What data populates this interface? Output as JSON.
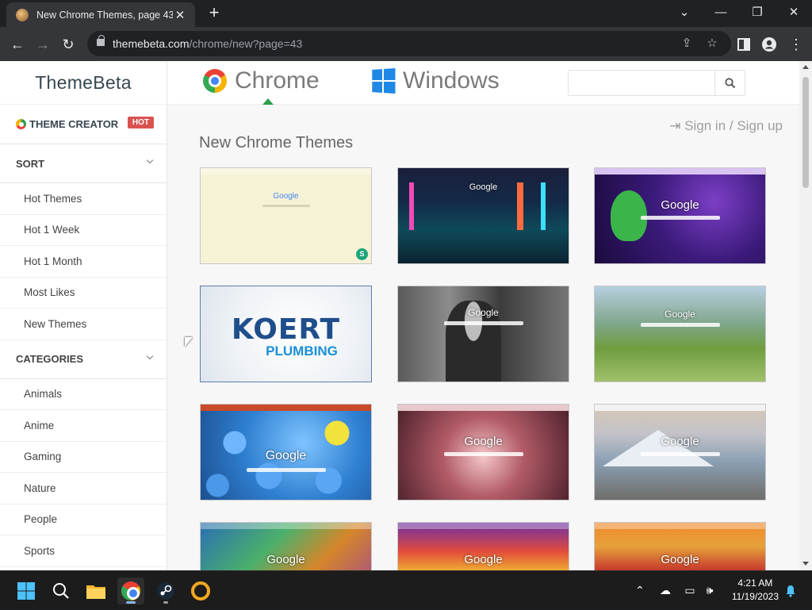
{
  "browser": {
    "tab_title": "New Chrome Themes, page 43 -",
    "url_host": "themebeta.com",
    "url_path": "/chrome/new?page=43"
  },
  "sidebar": {
    "logo": "ThemeBeta",
    "creator_label": "THEME CREATOR",
    "creator_badge": "HOT",
    "sort_heading": "SORT",
    "sort_items": [
      {
        "label": "Hot Themes"
      },
      {
        "label": "Hot 1 Week"
      },
      {
        "label": "Hot 1 Month"
      },
      {
        "label": "Most Likes"
      },
      {
        "label": "New Themes"
      }
    ],
    "categories_heading": "CATEGORIES",
    "category_items": [
      {
        "label": "Animals"
      },
      {
        "label": "Anime"
      },
      {
        "label": "Gaming"
      },
      {
        "label": "Nature"
      },
      {
        "label": "People"
      },
      {
        "label": "Sports"
      }
    ]
  },
  "topnav": {
    "chrome_label": "Chrome",
    "windows_label": "Windows",
    "search_placeholder": ""
  },
  "main": {
    "signin": "Sign in / Sign up",
    "heading": "New Chrome Themes",
    "thumbnails": [
      {
        "name": "pastel-cream-theme",
        "google": "Google",
        "badge": "S"
      },
      {
        "name": "neon-city-street-theme",
        "google": "Google"
      },
      {
        "name": "green-frog-space-theme",
        "google": "Google"
      },
      {
        "name": "koert-plumbing-theme",
        "brand": "KOERT",
        "sub": "PLUMBING"
      },
      {
        "name": "monochrome-singer-theme",
        "google": "Google"
      },
      {
        "name": "green-meadow-theme",
        "google": "Google"
      },
      {
        "name": "blue-smiley-balls-theme",
        "google": "Google"
      },
      {
        "name": "anime-girl-red-theme",
        "google": "Google"
      },
      {
        "name": "mount-fuji-girl-theme",
        "google": "Google"
      },
      {
        "name": "colorful-abstract-theme-1",
        "google": "Google"
      },
      {
        "name": "rainbow-abstract-theme-2",
        "google": "Google"
      },
      {
        "name": "rainbow-abstract-theme-3",
        "google": "Google"
      }
    ]
  },
  "taskbar": {
    "time": "4:21 AM",
    "date": "11/19/2023"
  },
  "colors": {
    "hot_badge": "#d9534f",
    "chrome_green": "#2e9d4f",
    "windows_blue": "#1e88e5"
  }
}
